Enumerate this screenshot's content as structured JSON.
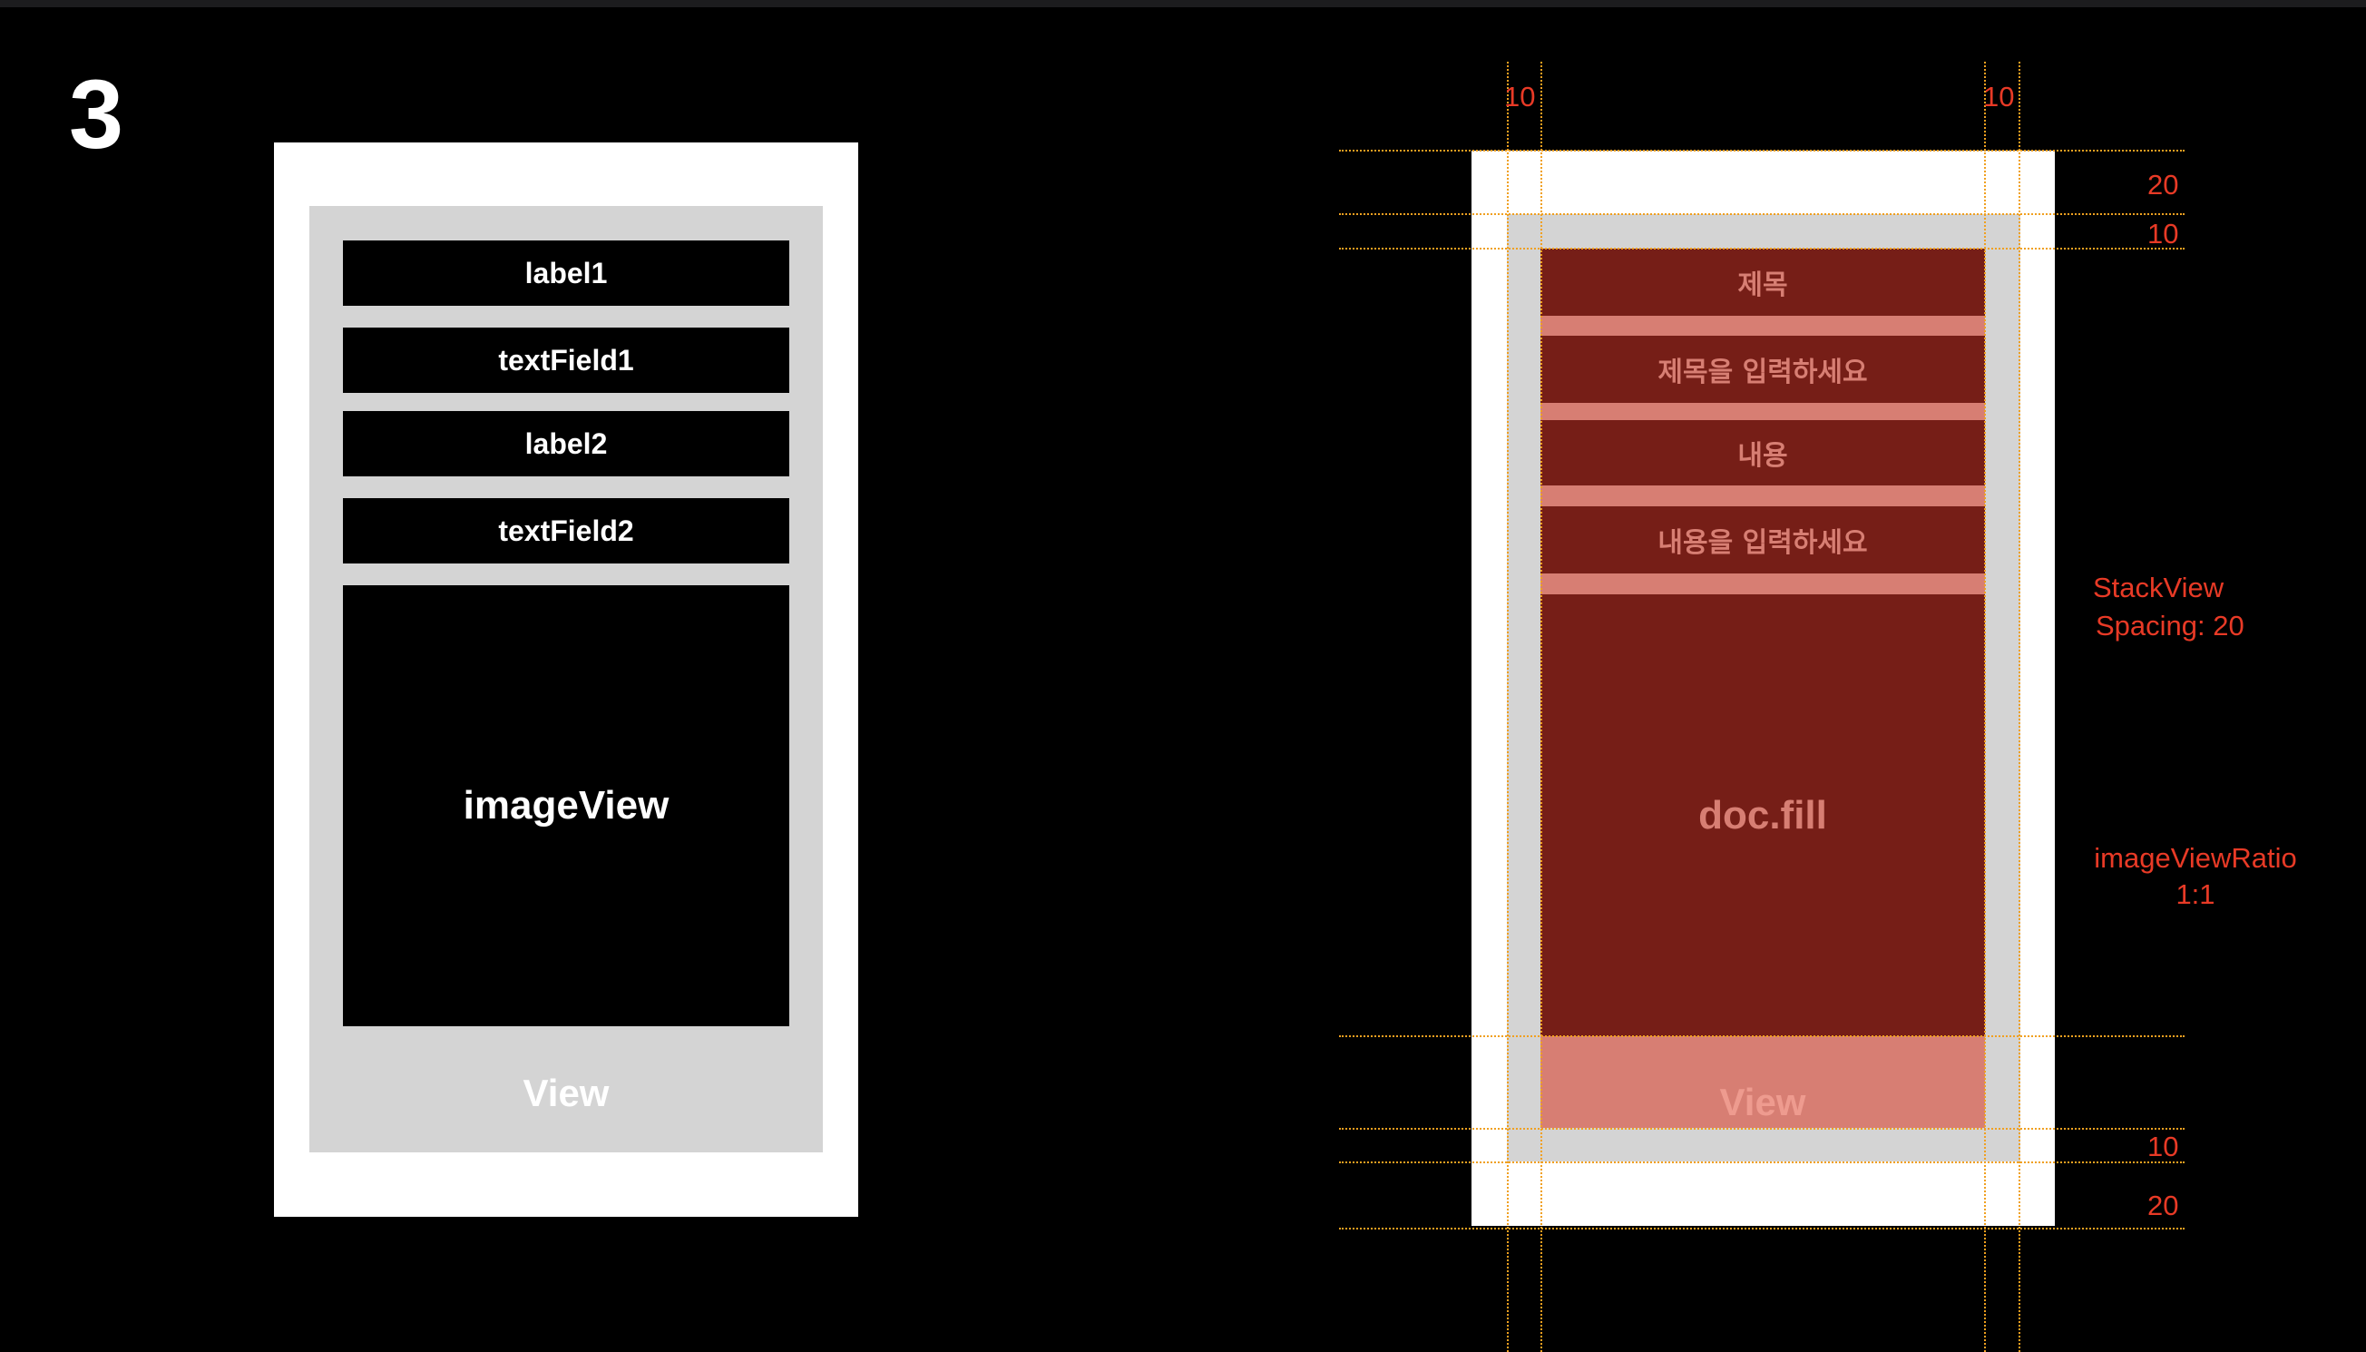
{
  "step_number": "3",
  "left_diagram": {
    "elements": [
      {
        "label": "label1"
      },
      {
        "label": "textField1"
      },
      {
        "label": "label2"
      },
      {
        "label": "textField2"
      },
      {
        "label": "imageView"
      }
    ],
    "container_label": "View"
  },
  "right_diagram": {
    "elements": [
      {
        "label": "제목"
      },
      {
        "label": "제목을 입력하세요"
      },
      {
        "label": "내용"
      },
      {
        "label": "내용을 입력하세요"
      },
      {
        "label": "doc.fill"
      }
    ],
    "container_label": "View",
    "annotations": {
      "left_margin": "10",
      "right_margin": "10",
      "top_outer": "20",
      "top_inner": "10",
      "bottom_inner": "10",
      "bottom_outer": "20",
      "stack_title": "StackView",
      "stack_spacing": "Spacing: 20",
      "ratio_title": "imageViewRatio",
      "ratio_value": "1:1"
    }
  },
  "colors": {
    "background": "#000000",
    "container_outer": "#ffffff",
    "container_inner": "#d4d4d4",
    "element_dark": "#761e17",
    "element_light": "#d77e73",
    "guide": "#f0a020",
    "annotation": "#e83a26"
  }
}
